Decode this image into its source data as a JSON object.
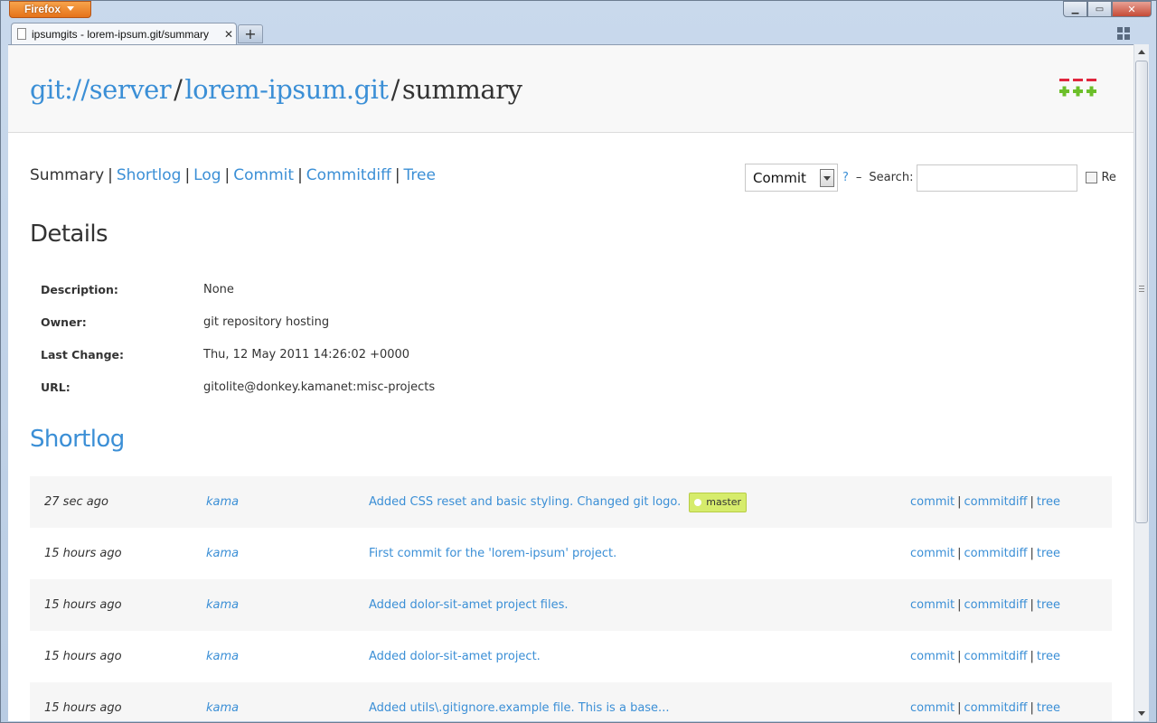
{
  "browser": {
    "app_button_label": "Firefox",
    "tab_title": "ipsumgits - lorem-ipsum.git/summary",
    "tab_close": "✕",
    "new_tab": "+",
    "minimize": "▁",
    "maximize": "▭",
    "close": "✕"
  },
  "header": {
    "crumbs": [
      "git://server",
      "lorem-ipsum.git",
      "summary"
    ],
    "separator": "/"
  },
  "nav": {
    "items": [
      "Summary",
      "Shortlog",
      "Log",
      "Commit",
      "Commitdiff",
      "Tree"
    ],
    "separator": "|"
  },
  "search": {
    "type_selected": "Commit",
    "help": "?",
    "dash": "–",
    "label": "Search:",
    "value": "",
    "regex_label": "Re"
  },
  "details": {
    "title": "Details",
    "rows": [
      {
        "label": "Description:",
        "value": "None"
      },
      {
        "label": "Owner:",
        "value": "git repository hosting"
      },
      {
        "label": "Last Change:",
        "value": "Thu, 12 May 2011 14:26:02 +0000"
      },
      {
        "label": "URL:",
        "value": "gitolite@donkey.kamanet:misc-projects"
      }
    ]
  },
  "shortlog": {
    "title": "Shortlog",
    "link_labels": [
      "commit",
      "commitdiff",
      "tree"
    ],
    "link_separator": "|",
    "rows": [
      {
        "age": "27 sec ago",
        "author": "kama",
        "message": "Added CSS reset and basic styling. Changed git logo.",
        "tag": "master"
      },
      {
        "age": "15 hours ago",
        "author": "kama",
        "message": "First commit for the 'lorem-ipsum' project.",
        "tag": ""
      },
      {
        "age": "15 hours ago",
        "author": "kama",
        "message": "Added dolor-sit-amet project files.",
        "tag": ""
      },
      {
        "age": "15 hours ago",
        "author": "kama",
        "message": "Added dolor-sit-amet project.",
        "tag": ""
      },
      {
        "age": "15 hours ago",
        "author": "kama",
        "message": "Added utils\\.gitignore.example file. This is a base...",
        "tag": ""
      }
    ]
  },
  "colors": {
    "link": "#3b8fd6",
    "text": "#333333",
    "row_stripe": "#f6f6f6",
    "tag_bg": "#d6ec6c",
    "logo_red": "#e0263d",
    "logo_green": "#6cbf2a"
  },
  "icons": [
    "page-icon",
    "tabgroups-icon",
    "git-logo",
    "dropdown-arrow-icon",
    "scroll-up-icon",
    "scroll-down-icon",
    "branch-dot-icon"
  ]
}
